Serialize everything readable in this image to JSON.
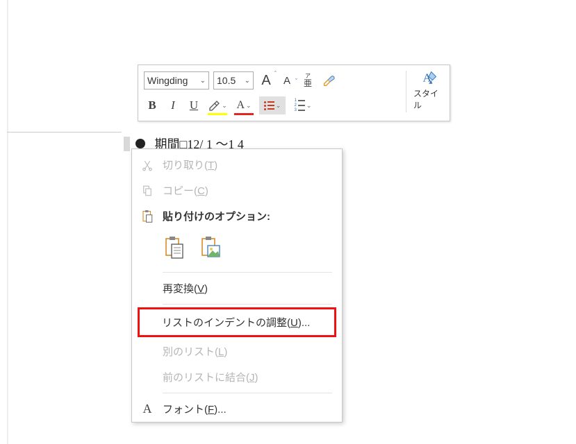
{
  "toolbar": {
    "font_name": "Wingding",
    "font_size": "10.5",
    "grow_font": "A",
    "shrink_font": "A",
    "ruby_top": "ア",
    "ruby_bottom": "亜",
    "bold": "B",
    "italic": "I",
    "underline": "U",
    "style_label": "スタイル"
  },
  "doc": {
    "bullet_text": "期間□12/ 1 ～1 4"
  },
  "menu": {
    "cut": "切り取り(",
    "cut_key": "T",
    "cut_end": ")",
    "copy": "コピー(",
    "copy_key": "C",
    "copy_end": ")",
    "paste_header": "貼り付けのオプション:",
    "reconvert": "再変換(",
    "reconvert_key": "V",
    "reconvert_end": ")",
    "adjust_indent": "リストのインデントの調整(",
    "adjust_indent_key": "U",
    "adjust_indent_end": ")...",
    "other_list": "別のリスト(",
    "other_list_key": "L",
    "other_list_end": ")",
    "join_prev": "前のリストに結合(",
    "join_prev_key": "J",
    "join_prev_end": ")",
    "font": "フォント(",
    "font_key": "F",
    "font_end": ")..."
  }
}
